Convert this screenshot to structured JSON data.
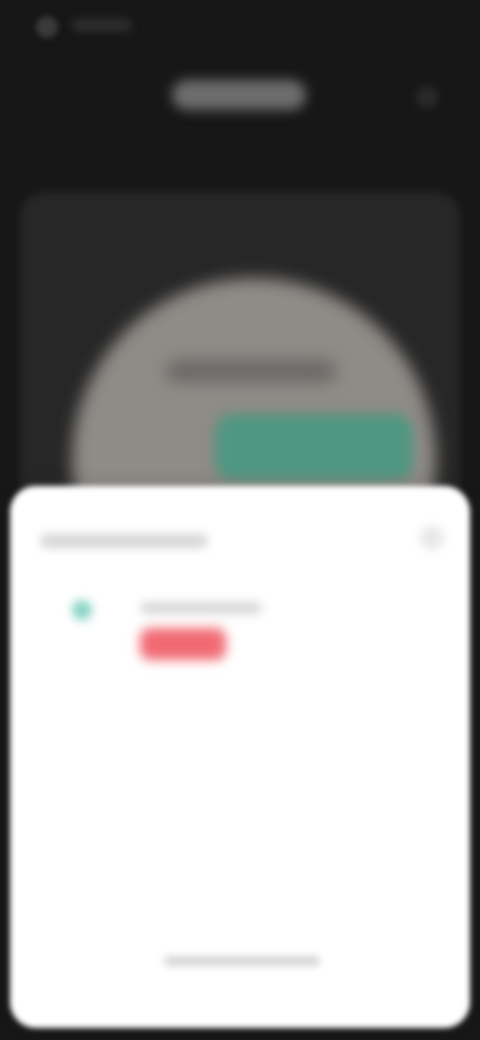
{
  "colors": {
    "background": "#171717",
    "card": "#272727",
    "preview_circle": "#8f8b87",
    "accent_green": "#4f9781",
    "sheet": "#ffffff",
    "teal_icon": "#86d3c3",
    "badge_red": "#f16a73"
  },
  "header": {
    "title": "",
    "menu_icon": "more-icon"
  },
  "preview": {
    "heading": "",
    "cta_label": ""
  },
  "sheet": {
    "title": "",
    "close_icon": "close-icon",
    "items": [
      {
        "icon": "teal-dot-icon",
        "label": "",
        "badge": ""
      }
    ]
  }
}
